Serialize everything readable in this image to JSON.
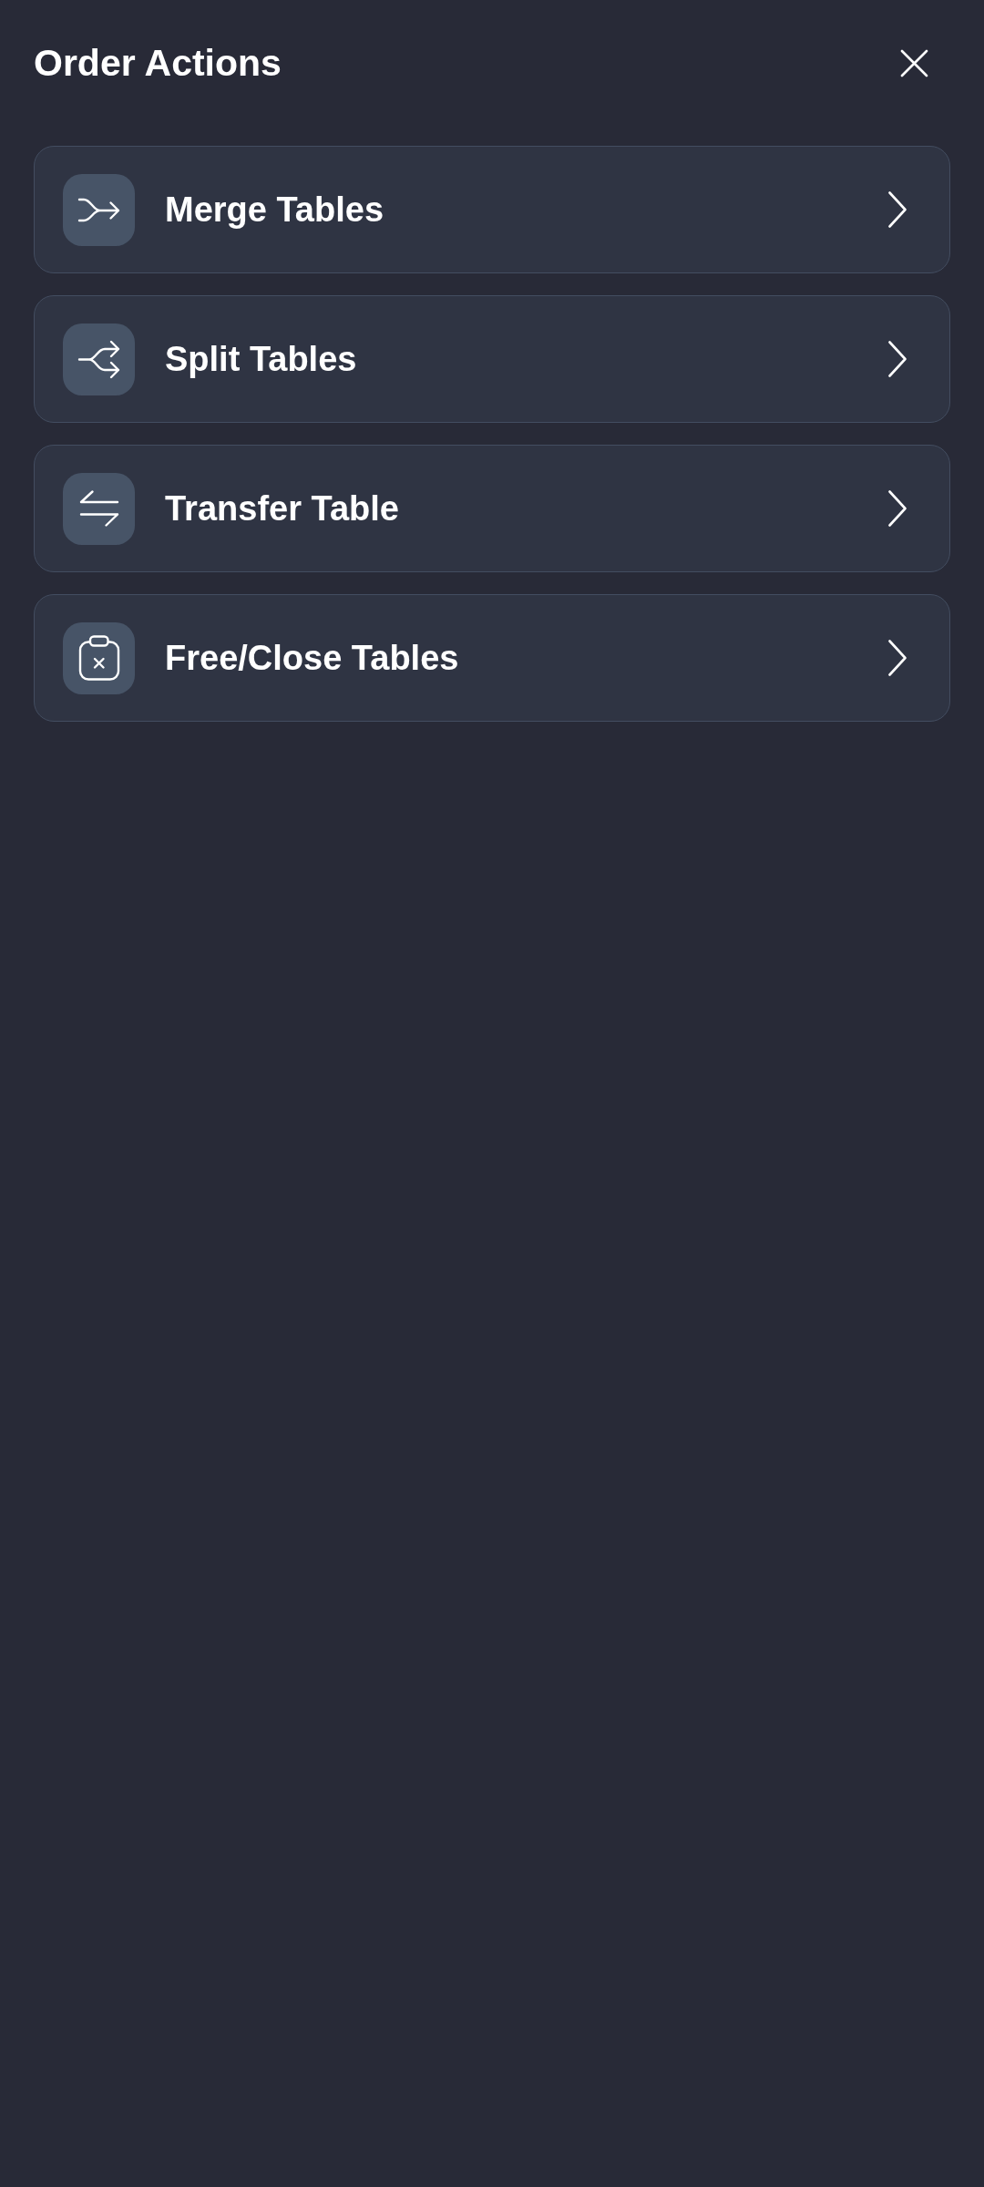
{
  "header": {
    "title": "Order Actions"
  },
  "actions": [
    {
      "label": "Merge Tables"
    },
    {
      "label": "Split Tables"
    },
    {
      "label": "Transfer Table"
    },
    {
      "label": "Free/Close Tables"
    }
  ]
}
